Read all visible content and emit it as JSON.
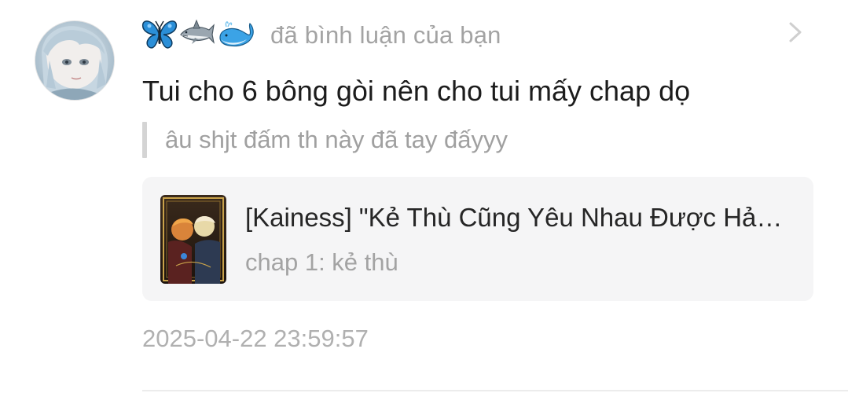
{
  "notification": {
    "user_emojis": [
      "butterfly-emoji",
      "shark-emoji",
      "whale-emoji"
    ],
    "action_text": "đã bình luận của bạn",
    "comment_text": "Tui cho 6 bông gòi nên cho tui mấy chap dọ",
    "quoted_comment": "âu shjt đấm th này đã tay đấyyy",
    "story_card": {
      "title": "[Kainess] \"Kẻ Thù Cũng Yêu Nhau Được Hả??…",
      "chapter": "chap 1: kẻ thù"
    },
    "timestamp": "2025-04-22 23:59:57"
  },
  "icons": {
    "chevron": "chevron-right-icon"
  },
  "colors": {
    "primary_text": "#1c1c1c",
    "secondary_text": "#a3a3a3",
    "card_background": "#f5f5f6",
    "quote_bar": "#d4d4d4",
    "butterfly": "#2b8fd8",
    "whale": "#3ba3e6"
  }
}
